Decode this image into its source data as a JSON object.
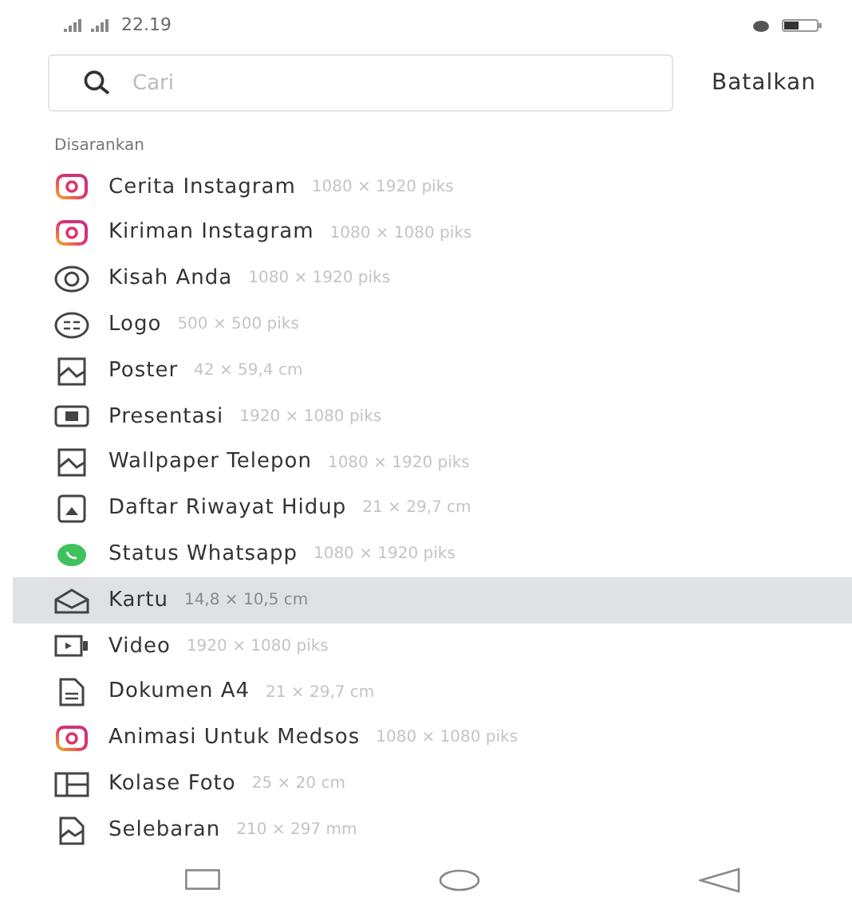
{
  "status_bar": {
    "time": "22.19"
  },
  "search": {
    "placeholder": "Cari",
    "cancel": "Batalkan"
  },
  "section_title": "Disarankan",
  "items": [
    {
      "kind": "instagram",
      "name": "Cerita Instagram",
      "size": "1080 × 1920 piks",
      "selected": false
    },
    {
      "kind": "instagram",
      "name": "Kiriman Instagram",
      "size": "1080 × 1080 piks",
      "selected": false
    },
    {
      "kind": "story",
      "name": "Kisah Anda",
      "size": "1080 × 1920 piks",
      "selected": false
    },
    {
      "kind": "logo",
      "name": "Logo",
      "size": "500 × 500 piks",
      "selected": false
    },
    {
      "kind": "poster",
      "name": "Poster",
      "size": "42 × 59,4 cm",
      "selected": false
    },
    {
      "kind": "presentation",
      "name": "Presentasi",
      "size": "1920 × 1080 piks",
      "selected": false
    },
    {
      "kind": "poster",
      "name": "Wallpaper Telepon",
      "size": "1080 × 1920 piks",
      "selected": false
    },
    {
      "kind": "resume",
      "name": "Daftar Riwayat Hidup",
      "size": "21 × 29,7 cm",
      "selected": false
    },
    {
      "kind": "whatsapp",
      "name": "Status Whatsapp",
      "size": "1080 × 1920 piks",
      "selected": false
    },
    {
      "kind": "card",
      "name": "Kartu",
      "size": "14,8 × 10,5 cm",
      "selected": true
    },
    {
      "kind": "video",
      "name": "Video",
      "size": "1920 × 1080 piks",
      "selected": false
    },
    {
      "kind": "document",
      "name": "Dokumen A4",
      "size": "21 × 29,7 cm",
      "selected": false
    },
    {
      "kind": "instagram",
      "name": "Animasi Untuk Medsos",
      "size": "1080 × 1080 piks",
      "selected": false
    },
    {
      "kind": "collage",
      "name": "Kolase Foto",
      "size": "25 × 20 cm",
      "selected": false
    },
    {
      "kind": "flyer",
      "name": "Selebaran",
      "size": "210 × 297 mm",
      "selected": false
    }
  ]
}
